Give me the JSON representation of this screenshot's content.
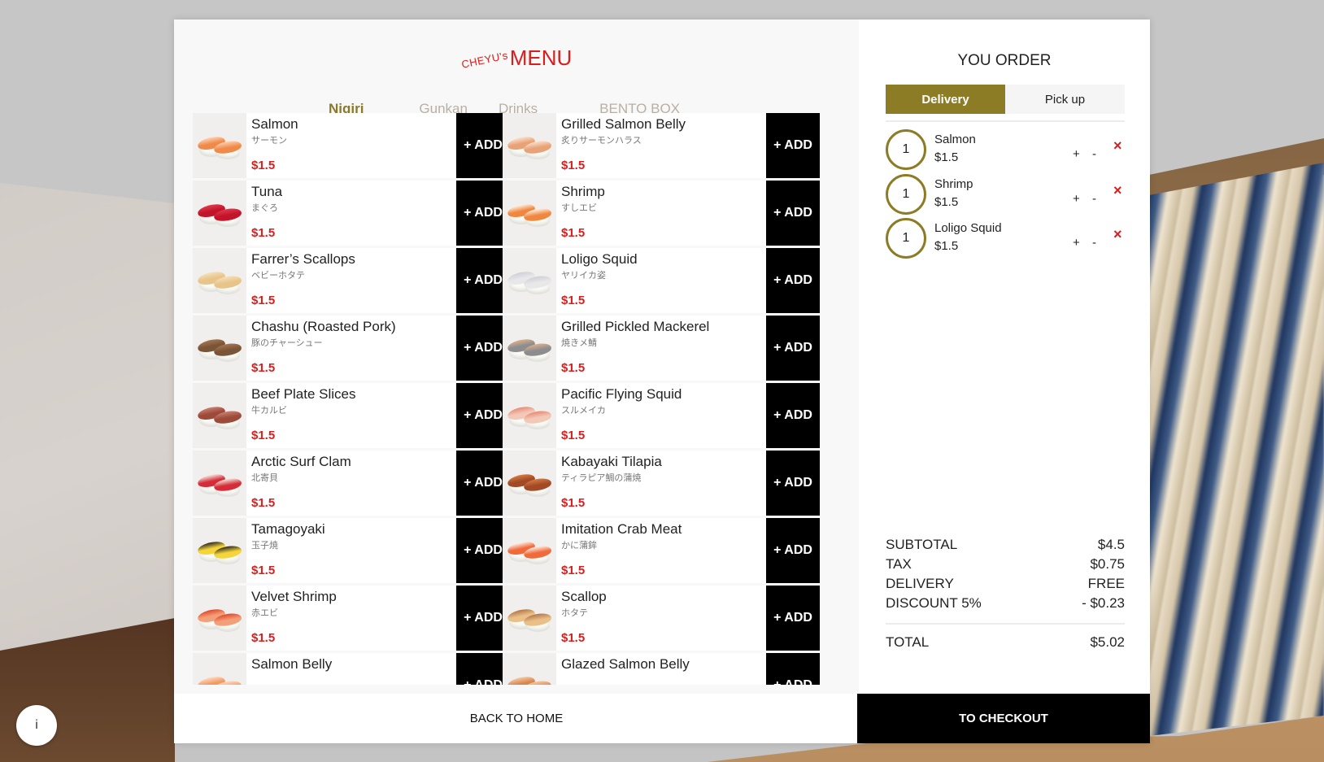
{
  "brand": {
    "small": "CHEYU's",
    "big": "MENU"
  },
  "tabs": [
    {
      "label": "Nigiri",
      "active": true
    },
    {
      "label": "Gunkan",
      "active": false
    },
    {
      "label": "Drinks",
      "active": false
    },
    {
      "label": "BENTO BOX",
      "active": false
    }
  ],
  "add_label": "+ ADD",
  "menu_items": [
    {
      "name": "Salmon",
      "jp": "サーモン",
      "price": "$1.5",
      "topping": "#f08a4b",
      "accent": "#ffd2b0"
    },
    {
      "name": "Grilled Salmon Belly",
      "jp": "炙りサーモンハラス",
      "price": "$1.5",
      "topping": "#e8a277",
      "accent": "#fbe1cc"
    },
    {
      "name": "Tuna",
      "jp": "まぐろ",
      "price": "$1.5",
      "topping": "#c2142a",
      "accent": "#e0394e"
    },
    {
      "name": "Shrimp",
      "jp": "すしエビ",
      "price": "$1.5",
      "topping": "#f0873f",
      "accent": "#fff0e0"
    },
    {
      "name": "Farrer’s Scallops",
      "jp": "ベビーホタテ",
      "price": "$1.5",
      "topping": "#e8c48a",
      "accent": "#f4e0b8"
    },
    {
      "name": "Loligo Squid",
      "jp": "ヤリイカ姿",
      "price": "$1.5",
      "topping": "#e8e8ea",
      "accent": "#cfcfd6"
    },
    {
      "name": "Chashu (Roasted Pork)",
      "jp": "豚のチャーシュー",
      "price": "$1.5",
      "topping": "#7a5436",
      "accent": "#a47653"
    },
    {
      "name": "Grilled Pickled Mackerel",
      "jp": "焼きメ鯖",
      "price": "$1.5",
      "topping": "#8d8c8f",
      "accent": "#d9b08a"
    },
    {
      "name": "Beef Plate Slices",
      "jp": "牛カルビ",
      "price": "$1.5",
      "topping": "#9c4a3a",
      "accent": "#c98070"
    },
    {
      "name": "Pacific Flying Squid",
      "jp": "スルメイカ",
      "price": "$1.5",
      "topping": "#f2c9b8",
      "accent": "#e88b76"
    },
    {
      "name": "Arctic Surf Clam",
      "jp": "北寄貝",
      "price": "$1.5",
      "topping": "#d62c3a",
      "accent": "#f3e6da"
    },
    {
      "name": "Kabayaki Tilapia",
      "jp": "ティラピア鯛の蒲焼",
      "price": "$1.5",
      "topping": "#a24a26",
      "accent": "#d67a42"
    },
    {
      "name": "Tamagoyaki",
      "jp": "玉子焼",
      "price": "$1.5",
      "topping": "#f5d53a",
      "accent": "#2d2a22"
    },
    {
      "name": "Imitation Crab Meat",
      "jp": "かに蒲鉾",
      "price": "$1.5",
      "topping": "#f06a3a",
      "accent": "#fff1e8"
    },
    {
      "name": "Velvet Shrimp",
      "jp": "赤エビ",
      "price": "$1.5",
      "topping": "#f3a07a",
      "accent": "#e04a2a"
    },
    {
      "name": "Scallop",
      "jp": "ホタテ",
      "price": "$1.5",
      "topping": "#e8c088",
      "accent": "#b5774a"
    },
    {
      "name": "Salmon Belly",
      "jp": "",
      "price": "",
      "topping": "#f09a64",
      "accent": "#ffd8bf"
    },
    {
      "name": "Glazed Salmon Belly",
      "jp": "",
      "price": "",
      "topping": "#d8864e",
      "accent": "#f5c9a3"
    }
  ],
  "order": {
    "title": "YOU ORDER",
    "delivery_label": "Delivery",
    "pickup_label": "Pick up",
    "items": [
      {
        "qty": "1",
        "name": "Salmon",
        "price": "$1.5"
      },
      {
        "qty": "1",
        "name": "Shrimp",
        "price": "$1.5"
      },
      {
        "qty": "1",
        "name": "Loligo Squid",
        "price": "$1.5"
      }
    ],
    "plus": "+",
    "minus": "-",
    "remove": "×",
    "summary": {
      "subtotal_label": "SUBTOTAL",
      "subtotal": "$4.5",
      "tax_label": "TAX",
      "tax": "$0.75",
      "delivery_label": "DELIVERY",
      "delivery": "FREE",
      "discount_label": "DISCOUNT 5%",
      "discount": "- $0.23",
      "total_label": "TOTAL",
      "total": "$5.02"
    }
  },
  "footer": {
    "back_label": "BACK TO HOME",
    "checkout_label": "TO CHECKOUT"
  },
  "info_label": "i",
  "colors": {
    "accent_gold": "#8c7c26",
    "price_red": "#d6201f",
    "button_black": "#000000"
  }
}
